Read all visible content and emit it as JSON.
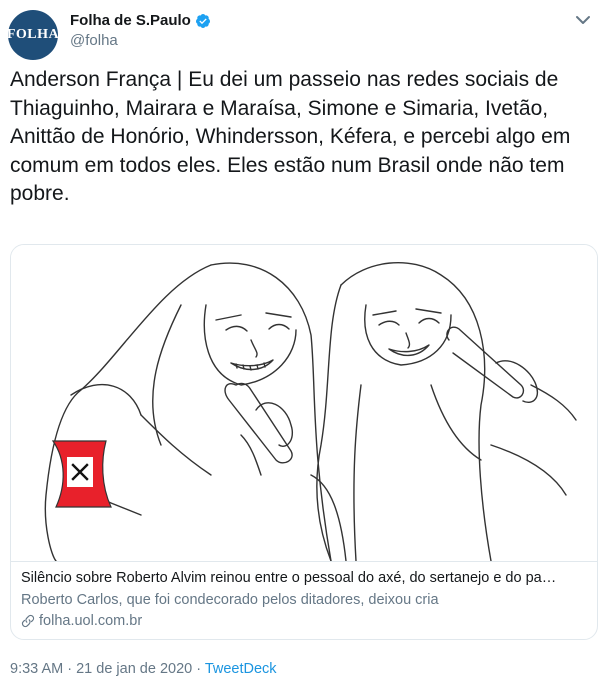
{
  "header": {
    "avatar_text": "FOLHA",
    "display_name": "Folha de S.Paulo",
    "handle": "@folha"
  },
  "tweet": {
    "text": "Anderson França | Eu dei um passeio nas redes sociais de Thiaguinho, Mairara e Maraísa, Simone e Simaria, Ivetão, Anittão de Honório, Whindersson, Kéfera, e percebi algo em comum em todos eles. Eles estão num Brasil onde não tem pobre."
  },
  "card": {
    "title": "Silêncio sobre Roberto Alvim reinou entre o pessoal do axé, do sertanejo e do pa…",
    "description": "Roberto Carlos, que foi condecorado pelos ditadores, deixou cria",
    "domain": "folha.uol.com.br"
  },
  "meta": {
    "time": "9:33 AM",
    "separator1": " · ",
    "date": "21 de jan de 2020",
    "separator2": " · ",
    "source": "TweetDeck"
  },
  "colors": {
    "brand_avatar": "#1f4e79",
    "verified": "#1da1f2",
    "link": "#1b95e0",
    "armband": "#e8212b"
  }
}
